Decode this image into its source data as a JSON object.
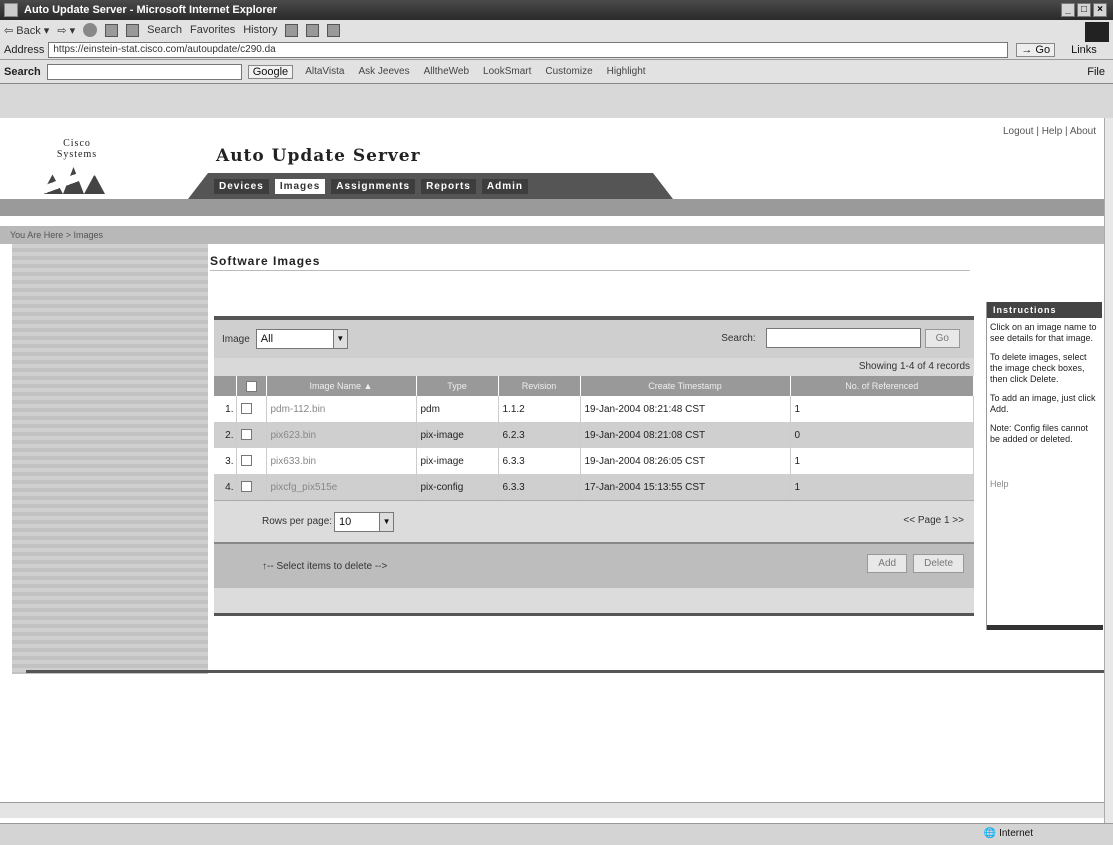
{
  "window": {
    "title": "Auto Update Server - Microsoft Internet Explorer"
  },
  "browser": {
    "toolbar": {
      "back": "Back",
      "search": "Search",
      "favorites": "Favorites",
      "history": "History"
    },
    "address_label": "Address",
    "address_url": "https://einstein-stat.cisco.com/autoupdate/c290.da",
    "go": "Go",
    "links": "Links",
    "searchbar": {
      "label": "Search",
      "google": "Google",
      "links": [
        "AltaVista",
        "Ask Jeeves",
        "AlltheWeb",
        "LookSmart",
        "Customize",
        "Highlight"
      ],
      "file": "File"
    },
    "status": {
      "zone": "Internet"
    }
  },
  "header": {
    "brand": "Cisco Systems",
    "app_title": "Auto Update Server",
    "top_links": "Logout | Help | About",
    "tabs": [
      "Devices",
      "Images",
      "Assignments",
      "Reports",
      "Admin"
    ],
    "active_tab": "Images",
    "breadcrumb": "You Are Here > Images"
  },
  "main": {
    "title": "Software Images",
    "filter": {
      "image_label": "Image",
      "image_value": "All",
      "search_label": "Search:",
      "go": "Go"
    },
    "showing": "Showing 1-4 of 4 records",
    "columns": [
      "Image Name",
      "Type",
      "Revision",
      "Create Timestamp",
      "No. of Referenced"
    ],
    "rows": [
      {
        "num": "1.",
        "name": "pdm-112.bin",
        "type": "pdm",
        "revision": "1.1.2",
        "timestamp": "19-Jan-2004 08:21:48 CST",
        "refs": "1"
      },
      {
        "num": "2.",
        "name": "pix623.bin",
        "type": "pix-image",
        "revision": "6.2.3",
        "timestamp": "19-Jan-2004 08:21:08 CST",
        "refs": "0"
      },
      {
        "num": "3.",
        "name": "pix633.bin",
        "type": "pix-image",
        "revision": "6.3.3",
        "timestamp": "19-Jan-2004 08:26:05 CST",
        "refs": "1"
      },
      {
        "num": "4.",
        "name": "pixcfg_pix515e",
        "type": "pix-config",
        "revision": "6.3.3",
        "timestamp": "17-Jan-2004 15:13:55 CST",
        "refs": "1"
      }
    ],
    "rows_per_page_label": "Rows per page:",
    "rows_per_page_value": "10",
    "page_indicator": "<< Page 1 >>",
    "delete_hint": "↑-- Select items to delete -->",
    "add": "Add",
    "delete": "Delete"
  },
  "instructions": {
    "title": "Instructions",
    "paragraphs": [
      "Click on an image name to see details for that image.",
      "To delete images, select the image check boxes, then click Delete.",
      "To add an image, just click Add.",
      "Note: Config files cannot be added or deleted."
    ],
    "help": "Help"
  }
}
